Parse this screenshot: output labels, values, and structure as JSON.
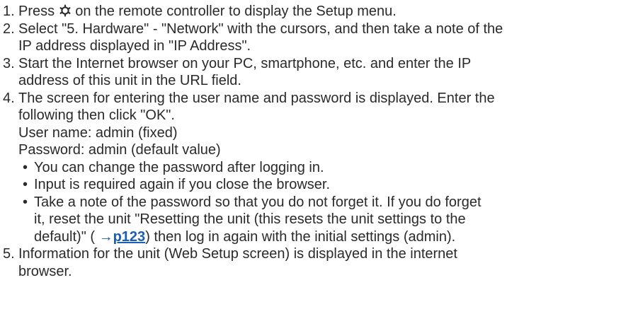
{
  "steps": [
    {
      "num": "1.",
      "before_icon": "Press ",
      "icon": "gear-icon",
      "after_icon": " on the remote controller to display the Setup menu."
    },
    {
      "num": "2.",
      "line1": "Select \"5. Hardware\" - \"Network\" with the cursors, and then take a note of the",
      "line2": "IP address displayed in \"IP Address\"."
    },
    {
      "num": "3.",
      "line1": "Start the Internet browser on your PC, smartphone, etc. and enter the IP",
      "line2": "address of this unit in the URL field."
    },
    {
      "num": "4.",
      "line1": "The screen for entering the user name and password is displayed. Enter the",
      "line2": "following then click \"OK\".",
      "user_name": "User name: admin (fixed)",
      "password": "Password: admin (default value)",
      "bullets": [
        {
          "text": "You can change the password after logging in."
        },
        {
          "text": "Input is required again if you close the browser."
        },
        {
          "line1": "Take a note of the password so that you do not forget it. If you do forget",
          "line2": "it, reset the unit \"Resetting the unit (this resets the unit settings to the",
          "line3_before": "default)\" ( ",
          "link_arrow": "→",
          "link_page": "p123",
          "line3_after": ") then log in again with the initial settings (admin)."
        }
      ]
    },
    {
      "num": "5.",
      "line1": "Information for the unit (Web Setup screen) is displayed in the internet",
      "line2": "browser."
    }
  ],
  "bullet_char": "•",
  "link_color": "#1a5fb4"
}
